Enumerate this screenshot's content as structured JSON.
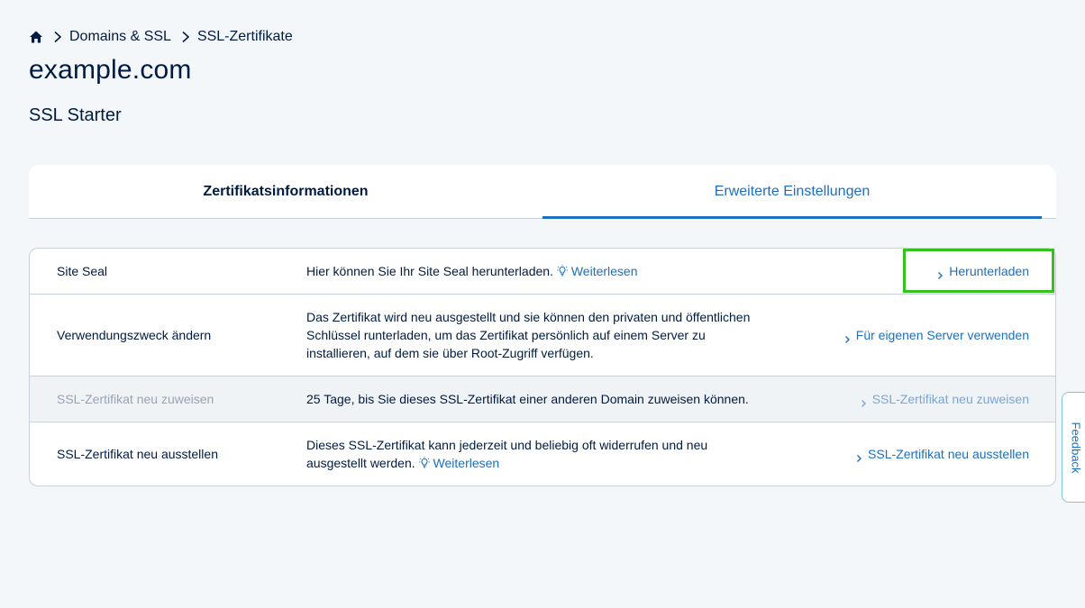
{
  "breadcrumb": {
    "home_icon": "home-icon",
    "items": [
      "Domains & SSL",
      "SSL-Zertifikate"
    ]
  },
  "page": {
    "domain": "example.com",
    "product": "SSL Starter"
  },
  "tabs": [
    {
      "label": "Zertifikatsinformationen",
      "active": false
    },
    {
      "label": "Erweiterte Einstellungen",
      "active": true
    }
  ],
  "rows": [
    {
      "label": "Site Seal",
      "description": "Hier können Sie Ihr Site Seal herunterladen.",
      "more_link": "Weiterlesen",
      "action": "Herunterladen"
    },
    {
      "label": "Verwendungszweck ändern",
      "description_lines": [
        "Das Zertifikat wird neu ausgestellt und sie können den privaten und öffentlichen",
        "Schlüssel runterladen, um das Zertifikat persönlich auf einem Server zu",
        "installieren, auf dem sie über Root-Zugriff verfügen."
      ],
      "action": "Für eigenen Server verwenden"
    },
    {
      "label": "SSL-Zertifikat neu zuweisen",
      "description": "25 Tage, bis Sie dieses SSL-Zertifikat einer anderen Domain zuweisen können.",
      "action": "SSL-Zertifikat neu zuweisen",
      "disabled": true
    },
    {
      "label": "SSL-Zertifikat neu ausstellen",
      "description_lines": [
        "Dieses SSL-Zertifikat kann jederzeit und beliebig oft widerrufen und neu",
        "ausgestellt werden."
      ],
      "more_link": "Weiterlesen",
      "action": "SSL-Zertifikat neu ausstellen"
    }
  ],
  "feedback": {
    "label": "Feedback"
  },
  "colors": {
    "accent": "#1c6fc1",
    "text": "#001b41",
    "highlight": "#35c21e",
    "background": "#f4f7fa"
  }
}
